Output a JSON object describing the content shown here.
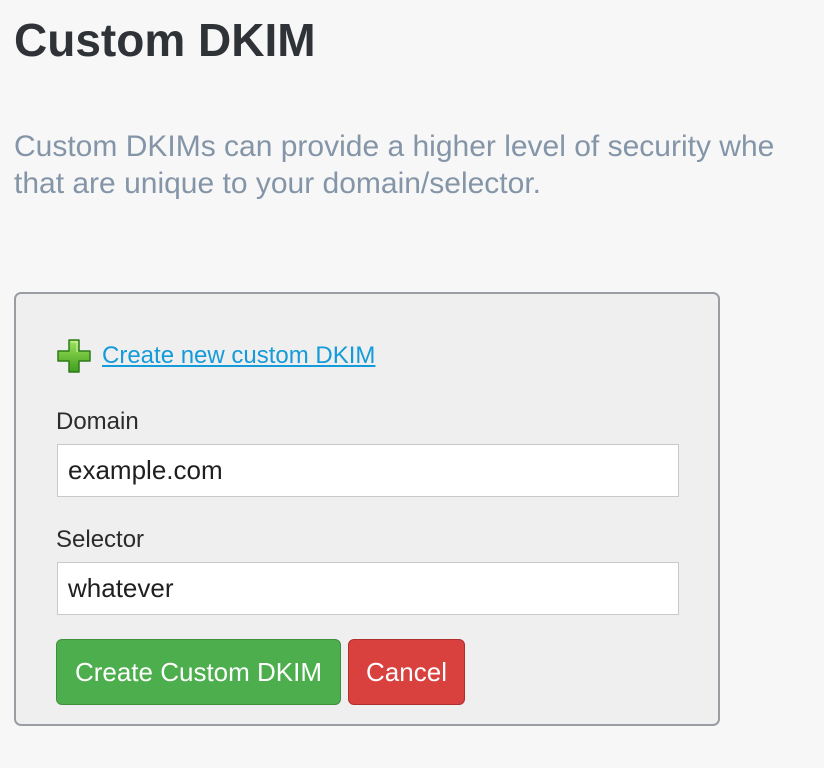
{
  "page": {
    "title": "Custom DKIM",
    "description_line1": "Custom DKIMs can provide a higher level of security whe",
    "description_line2": "that are unique to your domain/selector."
  },
  "form": {
    "create_link_label": "Create new custom DKIM",
    "create_icon": "plus-icon",
    "domain_label": "Domain",
    "domain_value": "example.com",
    "selector_label": "Selector",
    "selector_value": "whatever",
    "submit_label": "Create Custom DKIM",
    "cancel_label": "Cancel"
  },
  "colors": {
    "link": "#149bd9",
    "submit_button": "#4cae4c",
    "cancel_button": "#d9413f",
    "plus_icon": "#6cc53a"
  }
}
